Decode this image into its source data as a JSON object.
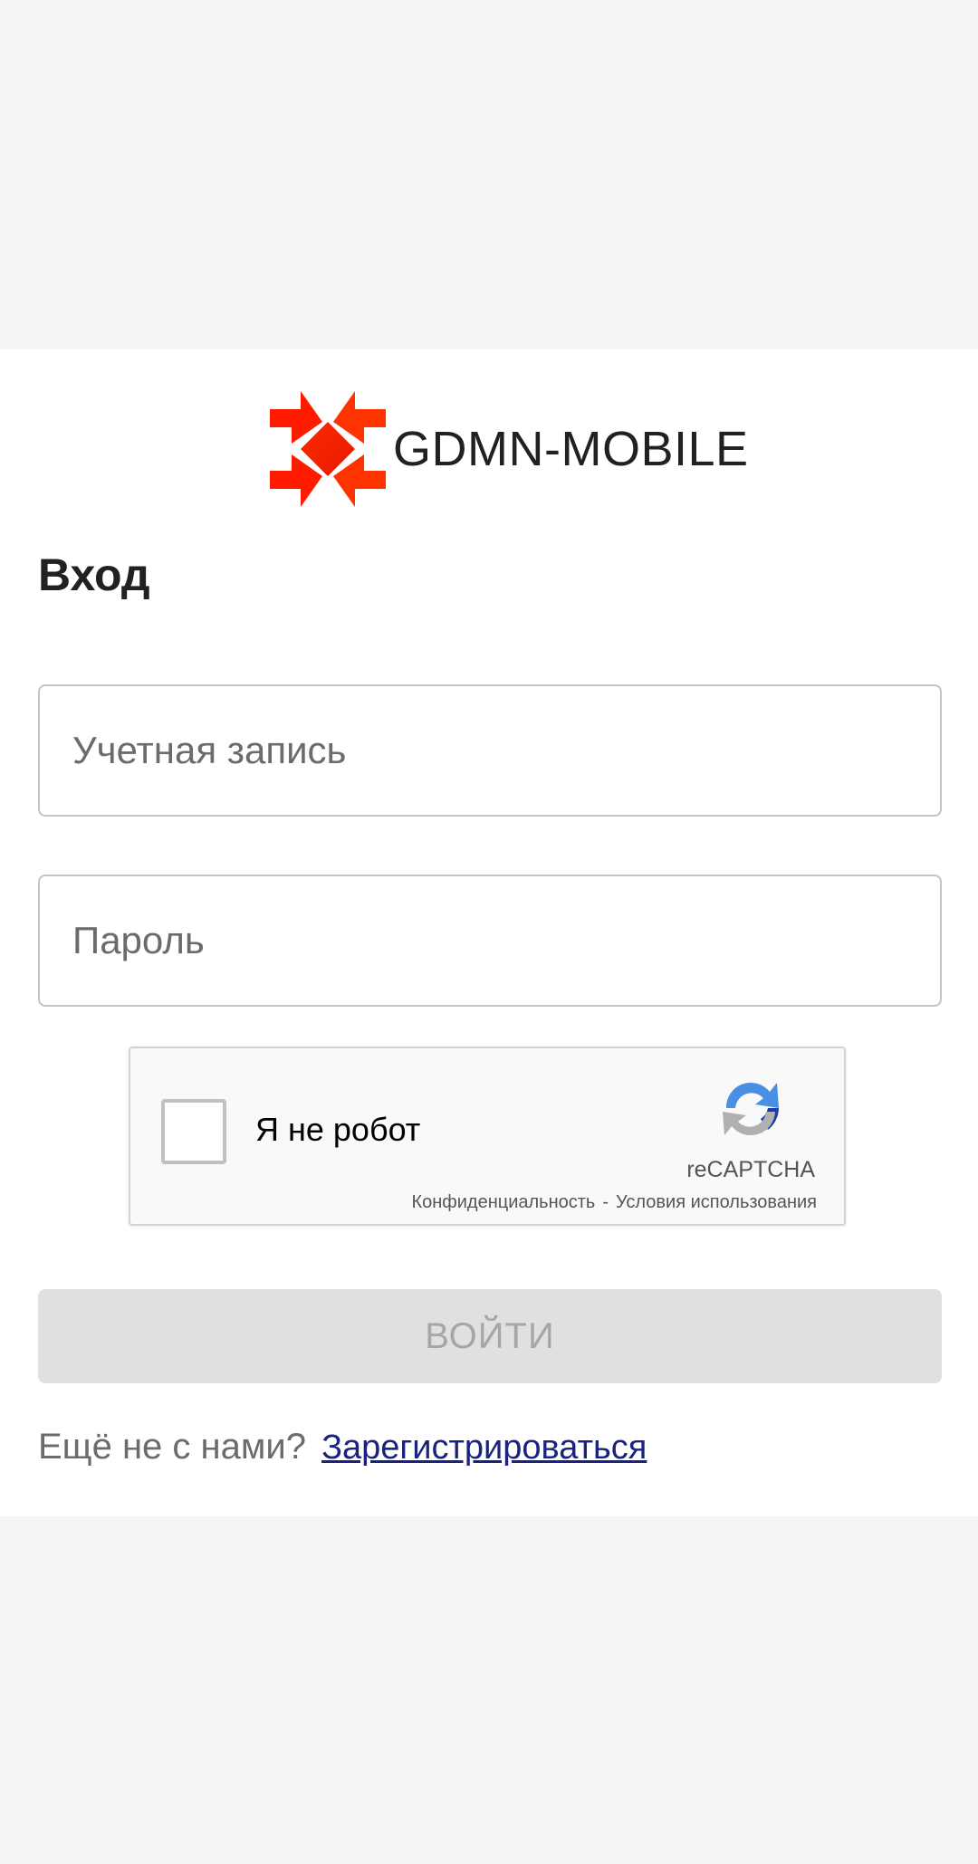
{
  "app": {
    "name": "GDMN-MOBILE"
  },
  "login": {
    "title": "Вход",
    "account_placeholder": "Учетная запись",
    "account_value": "",
    "password_placeholder": "Пароль",
    "password_value": "",
    "submit_label": "ВОЙТИ",
    "register_prompt": "Ещё не с нами?",
    "register_link": "Зарегистрироваться"
  },
  "captcha": {
    "label": "Я не робот",
    "brand": "reCAPTCHA",
    "privacy": "Конфиденциальность",
    "separator": "-",
    "terms": "Условия использования",
    "checked": false
  },
  "colors": {
    "page_background": "#f4f5f7",
    "card_background": "#ffffff",
    "logo_accent": "#ff1a00",
    "link": "#1a237e",
    "button_disabled_bg": "#e0e0e0",
    "button_disabled_text": "#a6a6a6"
  },
  "icons": {
    "brand_logo": "diamond-star-logo",
    "captcha_logo": "recaptcha-logo"
  }
}
